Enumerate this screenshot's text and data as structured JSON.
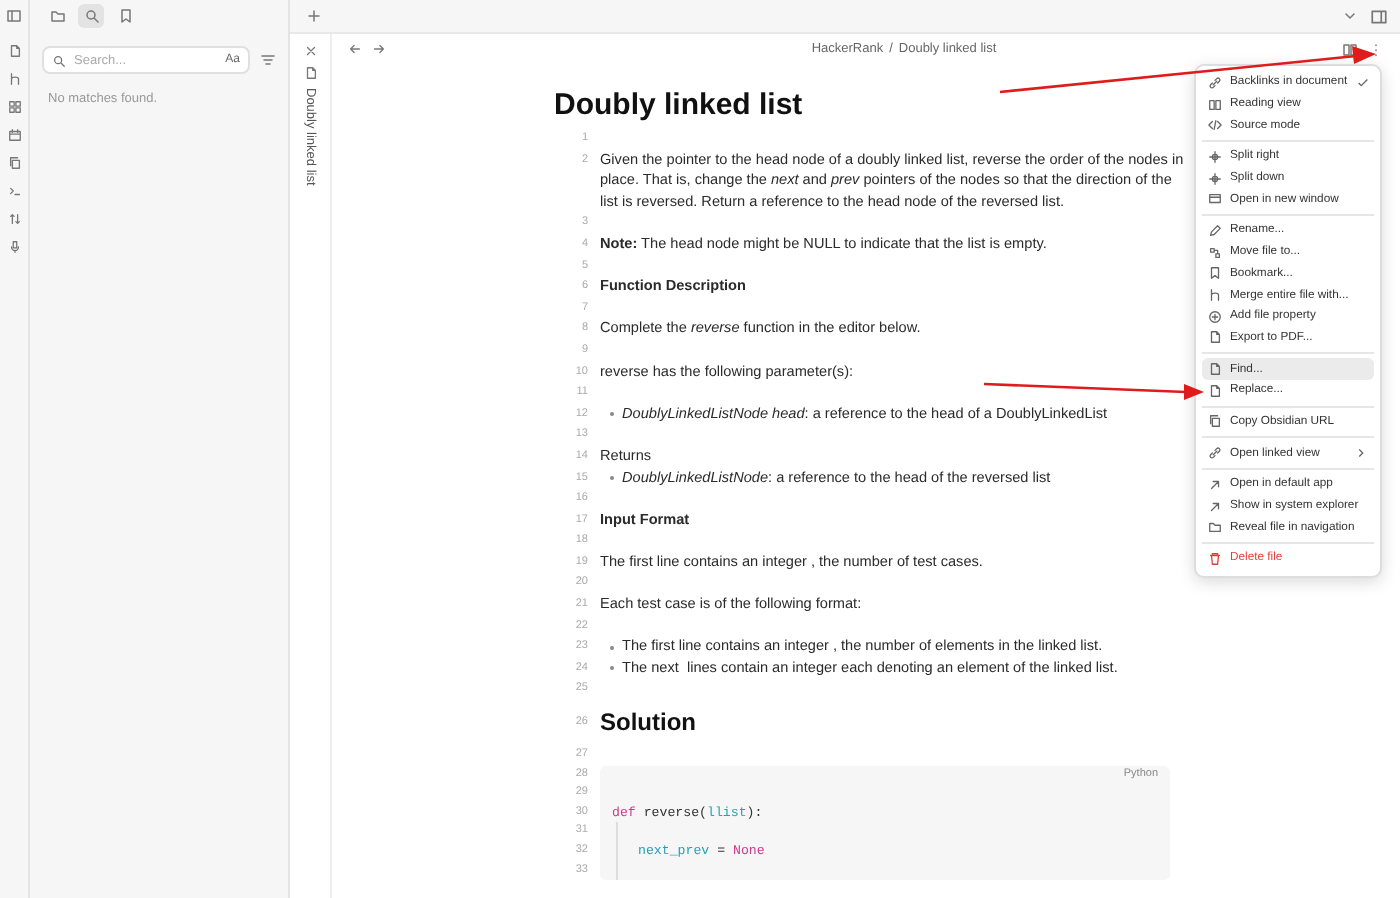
{
  "sidebar": {
    "tabs": [
      {
        "selected": false
      },
      {
        "selected": true
      },
      {
        "selected": false
      }
    ],
    "search": {
      "placeholder": "Search...",
      "match_case_label": "Aa"
    },
    "message": "No matches found."
  },
  "vertical_tab": {
    "title": "Doubly linked list"
  },
  "breadcrumb": {
    "parts": [
      "HackerRank",
      "Doubly linked list"
    ],
    "separator": "/"
  },
  "document": {
    "title": "Doubly linked list",
    "lines": [
      {
        "number": "1",
        "kind": "blank"
      },
      {
        "number": "2",
        "kind": "text",
        "text": "Given the pointer to the head node of a doubly linked list, reverse the order of the nodes in place. That is, change the *next* and *prev* pointers of the nodes so that the direction of the list is reversed. Return a reference to the head node of the reversed list."
      },
      {
        "number": "3",
        "kind": "blank"
      },
      {
        "number": "4",
        "kind": "text",
        "text": "**Note:** The head node might be NULL to indicate that the list is empty."
      },
      {
        "number": "5",
        "kind": "blank"
      },
      {
        "number": "6",
        "kind": "bold",
        "text": "Function Description"
      },
      {
        "number": "7",
        "kind": "blank"
      },
      {
        "number": "8",
        "kind": "text",
        "text": "Complete the *reverse* function in the editor below."
      },
      {
        "number": "9",
        "kind": "blank"
      },
      {
        "number": "10",
        "kind": "text",
        "text": "reverse has the following parameter(s):"
      },
      {
        "number": "11",
        "kind": "blank"
      },
      {
        "number": "12",
        "kind": "bullet",
        "text": "*DoublyLinkedListNode head*: a reference to the head of a DoublyLinkedList"
      },
      {
        "number": "13",
        "kind": "blank"
      },
      {
        "number": "14",
        "kind": "text",
        "text": "Returns"
      },
      {
        "number": "15",
        "kind": "bullet",
        "text": "*DoublyLinkedListNode*: a reference to the head of the reversed list"
      },
      {
        "number": "16",
        "kind": "blank"
      },
      {
        "number": "17",
        "kind": "bold",
        "text": "Input Format"
      },
      {
        "number": "18",
        "kind": "blank"
      },
      {
        "number": "19",
        "kind": "text",
        "text": "The first line contains an integer , the number of test cases."
      },
      {
        "number": "20",
        "kind": "blank"
      },
      {
        "number": "21",
        "kind": "text",
        "text": "Each test case is of the following format:"
      },
      {
        "number": "22",
        "kind": "blank"
      },
      {
        "number": "23",
        "kind": "bullet",
        "text": "The first line contains an integer , the number of elements in the linked list."
      },
      {
        "number": "24",
        "kind": "bullet",
        "text": "The next  lines contain an integer each denoting an element of the linked list."
      },
      {
        "number": "25",
        "kind": "blank"
      },
      {
        "number": "26",
        "kind": "heading",
        "text": "Solution"
      },
      {
        "number": "27",
        "kind": "blank"
      }
    ],
    "code_block": {
      "language": "Python",
      "lines": [
        {
          "number": "28",
          "kind": "top"
        },
        {
          "number": "29",
          "kind": "top"
        },
        {
          "number": "30",
          "kind": "top",
          "tokens": [
            {
              "text": "def",
              "kind": "keyword"
            },
            {
              "text": " reverse(",
              "kind": "plain"
            },
            {
              "text": "llist",
              "kind": "variable"
            },
            {
              "text": "):",
              "kind": "plain"
            }
          ]
        },
        {
          "number": "31",
          "kind": "indented"
        },
        {
          "number": "32",
          "kind": "indented",
          "tokens": [
            {
              "text": "next_prev",
              "kind": "variable"
            },
            {
              "text": " = ",
              "kind": "plain"
            },
            {
              "text": "None",
              "kind": "keyword"
            }
          ]
        },
        {
          "number": "33",
          "kind": "indented"
        }
      ]
    }
  },
  "menu": {
    "sections": [
      [
        {
          "label": "Backlinks in document",
          "kind": "normal",
          "checked": true,
          "selected": false,
          "submenu": false
        },
        {
          "label": "Reading view",
          "kind": "normal",
          "checked": false,
          "selected": false,
          "submenu": false
        },
        {
          "label": "Source mode",
          "kind": "normal",
          "checked": false,
          "selected": false,
          "submenu": false
        }
      ],
      [
        {
          "label": "Split right",
          "kind": "normal",
          "checked": false,
          "selected": false,
          "submenu": false
        },
        {
          "label": "Split down",
          "kind": "normal",
          "checked": false,
          "selected": false,
          "submenu": false
        },
        {
          "label": "Open in new window",
          "kind": "normal",
          "checked": false,
          "selected": false,
          "submenu": false
        }
      ],
      [
        {
          "label": "Rename...",
          "kind": "normal",
          "checked": false,
          "selected": false,
          "submenu": false
        },
        {
          "label": "Move file to...",
          "kind": "normal",
          "checked": false,
          "selected": false,
          "submenu": false
        },
        {
          "label": "Bookmark...",
          "kind": "normal",
          "checked": false,
          "selected": false,
          "submenu": false
        },
        {
          "label": "Merge entire file with...",
          "kind": "normal",
          "checked": false,
          "selected": false,
          "submenu": false
        },
        {
          "label": "Add file property",
          "kind": "normal",
          "checked": false,
          "selected": false,
          "submenu": false
        },
        {
          "label": "Export to PDF...",
          "kind": "normal",
          "checked": false,
          "selected": false,
          "submenu": false
        }
      ],
      [
        {
          "label": "Find...",
          "kind": "normal",
          "checked": false,
          "selected": true,
          "submenu": false
        },
        {
          "label": "Replace...",
          "kind": "normal",
          "checked": false,
          "selected": false,
          "submenu": false
        }
      ],
      [
        {
          "label": "Copy Obsidian URL",
          "kind": "normal",
          "checked": false,
          "selected": false,
          "submenu": false
        }
      ],
      [
        {
          "label": "Open linked view",
          "kind": "normal",
          "checked": false,
          "selected": false,
          "submenu": true
        }
      ],
      [
        {
          "label": "Open in default app",
          "kind": "normal",
          "checked": false,
          "selected": false,
          "submenu": false
        },
        {
          "label": "Show in system explorer",
          "kind": "normal",
          "checked": false,
          "selected": false,
          "submenu": false
        },
        {
          "label": "Reveal file in navigation",
          "kind": "normal",
          "checked": false,
          "selected": false,
          "submenu": false
        }
      ],
      [
        {
          "label": "Delete file",
          "kind": "danger",
          "checked": false,
          "selected": false,
          "submenu": false
        }
      ]
    ]
  }
}
